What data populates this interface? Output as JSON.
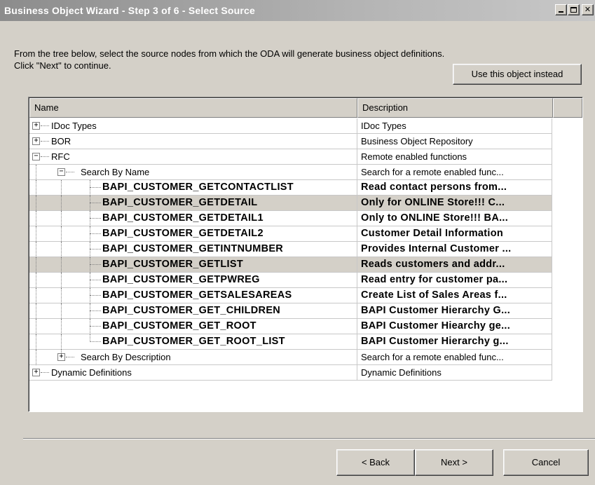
{
  "window": {
    "title": "Business Object Wizard - Step 3 of 6 - Select Source"
  },
  "instructions": {
    "line1": "From the tree below, select the source nodes from which the ODA will generate business object definitions.",
    "line2": "Click \"Next\" to continue."
  },
  "buttons": {
    "use_object": "Use this object instead",
    "back": "< Back",
    "next": "Next >",
    "cancel": "Cancel"
  },
  "tree": {
    "columns": [
      "Name",
      "Description"
    ],
    "rows": [
      {
        "name": "IDoc Types",
        "description": "IDoc Types",
        "expander": "+"
      },
      {
        "name": "BOR",
        "description": "Business Object Repository",
        "expander": "+"
      },
      {
        "name": "RFC",
        "description": "Remote enabled functions",
        "expander": "−"
      },
      {
        "name": "Search By Name",
        "description": "Search for a remote enabled func...",
        "expander": "−"
      },
      {
        "name": "BAPI_CUSTOMER_GETCONTACTLIST",
        "description": "Read contact persons from..."
      },
      {
        "name": "BAPI_CUSTOMER_GETDETAIL",
        "description": "Only for ONLINE Store!!! C...",
        "selected": true
      },
      {
        "name": "BAPI_CUSTOMER_GETDETAIL1",
        "description": "Only to ONLINE Store!!! BA..."
      },
      {
        "name": "BAPI_CUSTOMER_GETDETAIL2",
        "description": "Customer Detail Information"
      },
      {
        "name": "BAPI_CUSTOMER_GETINTNUMBER",
        "description": "Provides Internal Customer ..."
      },
      {
        "name": "BAPI_CUSTOMER_GETLIST",
        "description": "Reads customers and addr...",
        "selected": true
      },
      {
        "name": "BAPI_CUSTOMER_GETPWREG",
        "description": "Read entry for customer pa..."
      },
      {
        "name": "BAPI_CUSTOMER_GETSALESAREAS",
        "description": "Create List of Sales Areas f..."
      },
      {
        "name": "BAPI_CUSTOMER_GET_CHILDREN",
        "description": "BAPI Customer Hierarchy G..."
      },
      {
        "name": "BAPI_CUSTOMER_GET_ROOT",
        "description": "BAPI Customer Hiearchy ge..."
      },
      {
        "name": "BAPI_CUSTOMER_GET_ROOT_LIST",
        "description": "BAPI Customer Hierarchy g..."
      },
      {
        "name": "Search By Description",
        "description": "Search for a remote enabled func...",
        "expander": "+"
      },
      {
        "name": "Dynamic Definitions",
        "description": "Dynamic Definitions",
        "expander": "+"
      }
    ]
  }
}
